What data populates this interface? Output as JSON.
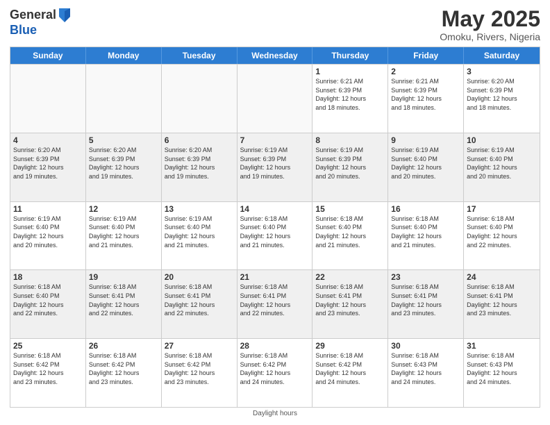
{
  "logo": {
    "line1": "General",
    "line2": "Blue"
  },
  "title": "May 2025",
  "location": "Omoku, Rivers, Nigeria",
  "weekdays": [
    "Sunday",
    "Monday",
    "Tuesday",
    "Wednesday",
    "Thursday",
    "Friday",
    "Saturday"
  ],
  "weeks": [
    [
      {
        "day": "",
        "info": "",
        "empty": true
      },
      {
        "day": "",
        "info": "",
        "empty": true
      },
      {
        "day": "",
        "info": "",
        "empty": true
      },
      {
        "day": "",
        "info": "",
        "empty": true
      },
      {
        "day": "1",
        "info": "Sunrise: 6:21 AM\nSunset: 6:39 PM\nDaylight: 12 hours\nand 18 minutes."
      },
      {
        "day": "2",
        "info": "Sunrise: 6:21 AM\nSunset: 6:39 PM\nDaylight: 12 hours\nand 18 minutes."
      },
      {
        "day": "3",
        "info": "Sunrise: 6:20 AM\nSunset: 6:39 PM\nDaylight: 12 hours\nand 18 minutes."
      }
    ],
    [
      {
        "day": "4",
        "info": "Sunrise: 6:20 AM\nSunset: 6:39 PM\nDaylight: 12 hours\nand 19 minutes."
      },
      {
        "day": "5",
        "info": "Sunrise: 6:20 AM\nSunset: 6:39 PM\nDaylight: 12 hours\nand 19 minutes."
      },
      {
        "day": "6",
        "info": "Sunrise: 6:20 AM\nSunset: 6:39 PM\nDaylight: 12 hours\nand 19 minutes."
      },
      {
        "day": "7",
        "info": "Sunrise: 6:19 AM\nSunset: 6:39 PM\nDaylight: 12 hours\nand 19 minutes."
      },
      {
        "day": "8",
        "info": "Sunrise: 6:19 AM\nSunset: 6:39 PM\nDaylight: 12 hours\nand 20 minutes."
      },
      {
        "day": "9",
        "info": "Sunrise: 6:19 AM\nSunset: 6:40 PM\nDaylight: 12 hours\nand 20 minutes."
      },
      {
        "day": "10",
        "info": "Sunrise: 6:19 AM\nSunset: 6:40 PM\nDaylight: 12 hours\nand 20 minutes."
      }
    ],
    [
      {
        "day": "11",
        "info": "Sunrise: 6:19 AM\nSunset: 6:40 PM\nDaylight: 12 hours\nand 20 minutes."
      },
      {
        "day": "12",
        "info": "Sunrise: 6:19 AM\nSunset: 6:40 PM\nDaylight: 12 hours\nand 21 minutes."
      },
      {
        "day": "13",
        "info": "Sunrise: 6:19 AM\nSunset: 6:40 PM\nDaylight: 12 hours\nand 21 minutes."
      },
      {
        "day": "14",
        "info": "Sunrise: 6:18 AM\nSunset: 6:40 PM\nDaylight: 12 hours\nand 21 minutes."
      },
      {
        "day": "15",
        "info": "Sunrise: 6:18 AM\nSunset: 6:40 PM\nDaylight: 12 hours\nand 21 minutes."
      },
      {
        "day": "16",
        "info": "Sunrise: 6:18 AM\nSunset: 6:40 PM\nDaylight: 12 hours\nand 21 minutes."
      },
      {
        "day": "17",
        "info": "Sunrise: 6:18 AM\nSunset: 6:40 PM\nDaylight: 12 hours\nand 22 minutes."
      }
    ],
    [
      {
        "day": "18",
        "info": "Sunrise: 6:18 AM\nSunset: 6:40 PM\nDaylight: 12 hours\nand 22 minutes."
      },
      {
        "day": "19",
        "info": "Sunrise: 6:18 AM\nSunset: 6:41 PM\nDaylight: 12 hours\nand 22 minutes."
      },
      {
        "day": "20",
        "info": "Sunrise: 6:18 AM\nSunset: 6:41 PM\nDaylight: 12 hours\nand 22 minutes."
      },
      {
        "day": "21",
        "info": "Sunrise: 6:18 AM\nSunset: 6:41 PM\nDaylight: 12 hours\nand 22 minutes."
      },
      {
        "day": "22",
        "info": "Sunrise: 6:18 AM\nSunset: 6:41 PM\nDaylight: 12 hours\nand 23 minutes."
      },
      {
        "day": "23",
        "info": "Sunrise: 6:18 AM\nSunset: 6:41 PM\nDaylight: 12 hours\nand 23 minutes."
      },
      {
        "day": "24",
        "info": "Sunrise: 6:18 AM\nSunset: 6:41 PM\nDaylight: 12 hours\nand 23 minutes."
      }
    ],
    [
      {
        "day": "25",
        "info": "Sunrise: 6:18 AM\nSunset: 6:42 PM\nDaylight: 12 hours\nand 23 minutes."
      },
      {
        "day": "26",
        "info": "Sunrise: 6:18 AM\nSunset: 6:42 PM\nDaylight: 12 hours\nand 23 minutes."
      },
      {
        "day": "27",
        "info": "Sunrise: 6:18 AM\nSunset: 6:42 PM\nDaylight: 12 hours\nand 23 minutes."
      },
      {
        "day": "28",
        "info": "Sunrise: 6:18 AM\nSunset: 6:42 PM\nDaylight: 12 hours\nand 24 minutes."
      },
      {
        "day": "29",
        "info": "Sunrise: 6:18 AM\nSunset: 6:42 PM\nDaylight: 12 hours\nand 24 minutes."
      },
      {
        "day": "30",
        "info": "Sunrise: 6:18 AM\nSunset: 6:43 PM\nDaylight: 12 hours\nand 24 minutes."
      },
      {
        "day": "31",
        "info": "Sunrise: 6:18 AM\nSunset: 6:43 PM\nDaylight: 12 hours\nand 24 minutes."
      }
    ]
  ],
  "footer": "Daylight hours"
}
